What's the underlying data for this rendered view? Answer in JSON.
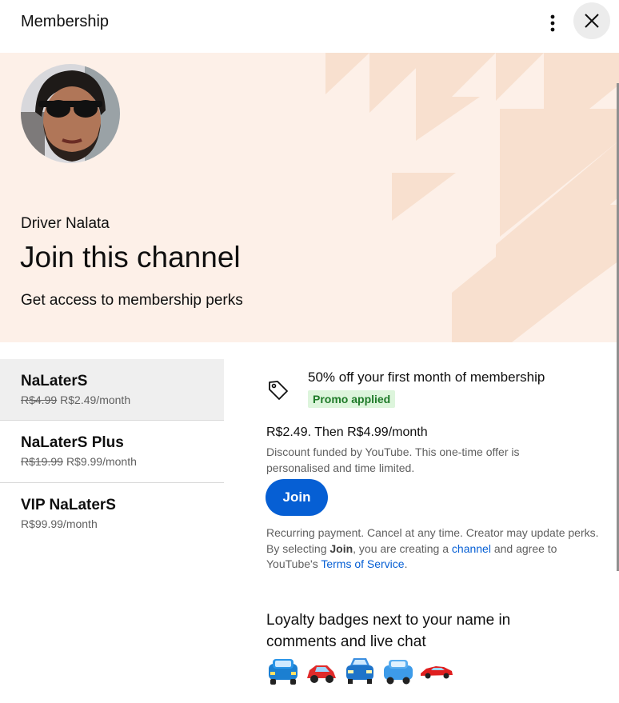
{
  "header": {
    "title": "Membership",
    "more_icon": "more-vert-icon",
    "close_icon": "close-icon"
  },
  "hero": {
    "creator_name": "Driver Nalata",
    "title": "Join this channel",
    "subtitle": "Get access to membership perks",
    "background_color": "#fdf0e8"
  },
  "tiers": [
    {
      "name": "NaLaterS",
      "old_price": "R$4.99",
      "price": "R$2.49/month",
      "selected": true
    },
    {
      "name": "NaLaterS Plus",
      "old_price": "R$19.99",
      "price": "R$9.99/month",
      "selected": false
    },
    {
      "name": "VIP NaLaterS",
      "old_price": "",
      "price": "R$99.99/month",
      "selected": false
    }
  ],
  "details": {
    "promo_icon": "tag-icon",
    "promo_text": "50% off your first month of membership",
    "promo_badge": "Promo applied",
    "price_line": "R$2.49. Then R$4.99/month",
    "discount_note": "Discount funded by YouTube. This one-time offer is personalised and time limited.",
    "join_label": "Join",
    "legal_recurring": "Recurring payment. Cancel at any time. Creator may update perks.",
    "legal_select_prefix": "By selecting ",
    "legal_select_bold": "Join",
    "legal_select_mid": ", you are creating a ",
    "legal_channel_link": "channel",
    "legal_agree": " and agree to YouTube's ",
    "legal_tos_link": "Terms of Service",
    "legal_end": ".",
    "perk_title": "Loyalty badges next to your name in comments and live chat",
    "badges": [
      "blue-car-badge",
      "red-car-badge",
      "blue-car-front-badge",
      "blue-car-badge-2",
      "red-sports-car-badge"
    ]
  },
  "colors": {
    "accent": "#065fd4",
    "promo_badge_bg": "#ddf5dc",
    "promo_badge_text": "#1e7a28"
  }
}
